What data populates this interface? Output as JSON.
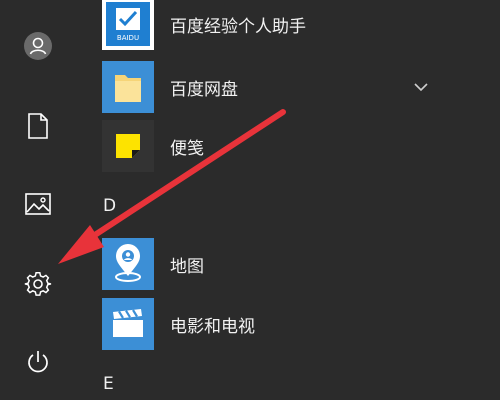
{
  "sidebar": {
    "items": [
      {
        "name": "user",
        "icon": "user-avatar-icon"
      },
      {
        "name": "documents",
        "icon": "document-icon"
      },
      {
        "name": "pictures",
        "icon": "picture-icon"
      },
      {
        "name": "settings",
        "icon": "gear-icon"
      },
      {
        "name": "power",
        "icon": "power-icon"
      }
    ]
  },
  "app_list": {
    "apps": [
      {
        "label": "百度经验个人助手",
        "icon": "baidu-jingyan-icon",
        "tile_color": "#00a2e8",
        "tile_text": "BAIDU"
      },
      {
        "label": "百度网盘",
        "icon": "folder-icon",
        "tile_color": "#3c8fd6"
      },
      {
        "label": "便笺",
        "icon": "sticky-note-icon",
        "tile_color": "#333333"
      },
      {
        "label": "地图",
        "icon": "maps-pin-icon",
        "tile_color": "#3c8fd6"
      },
      {
        "label": "电影和电视",
        "icon": "film-clapper-icon",
        "tile_color": "#3c8fd6"
      }
    ],
    "section_letters": [
      "D",
      "E"
    ]
  },
  "colors": {
    "background": "#2b2b2b",
    "accent": "#3c8fd6",
    "arrow": "#e8333a"
  }
}
